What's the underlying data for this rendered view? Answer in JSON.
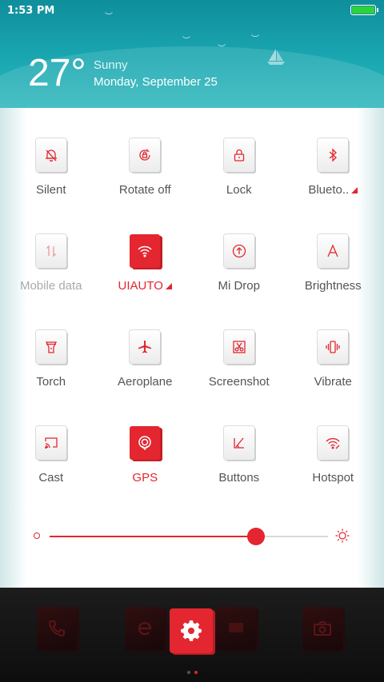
{
  "status_bar": {
    "time": "1:53 PM"
  },
  "weather": {
    "temperature": "27°",
    "condition": "Sunny",
    "date": "Monday, September 25"
  },
  "tiles": [
    {
      "name": "silent",
      "label": "Silent",
      "icon": "bell-off-icon"
    },
    {
      "name": "rotate-off",
      "label": "Rotate off",
      "icon": "rotation-lock-icon"
    },
    {
      "name": "lock",
      "label": "Lock",
      "icon": "padlock-icon"
    },
    {
      "name": "bluetooth",
      "label": "Blueto..",
      "icon": "bluetooth-icon"
    },
    {
      "name": "mobile-data",
      "label": "Mobile data",
      "icon": "data-arrows-icon"
    },
    {
      "name": "wifi",
      "label": "UIAUTO",
      "icon": "wifi-icon"
    },
    {
      "name": "mi-drop",
      "label": "Mi Drop",
      "icon": "upload-circle-icon"
    },
    {
      "name": "brightness",
      "label": "Brightness",
      "icon": "letter-a-icon"
    },
    {
      "name": "torch",
      "label": "Torch",
      "icon": "flashlight-icon"
    },
    {
      "name": "aeroplane",
      "label": "Aeroplane",
      "icon": "airplane-icon"
    },
    {
      "name": "screenshot",
      "label": "Screenshot",
      "icon": "scissors-icon"
    },
    {
      "name": "vibrate",
      "label": "Vibrate",
      "icon": "vibrate-icon"
    },
    {
      "name": "cast",
      "label": "Cast",
      "icon": "cast-icon"
    },
    {
      "name": "gps",
      "label": "GPS",
      "icon": "location-icon"
    },
    {
      "name": "buttons",
      "label": "Buttons",
      "icon": "buttons-icon"
    },
    {
      "name": "hotspot",
      "label": "Hotspot",
      "icon": "hotspot-icon"
    }
  ],
  "brightness": {
    "level": 0.74
  },
  "dock": {
    "apps": [
      "phone-icon",
      "browser-icon",
      "settings-icon",
      "messages-icon",
      "camera-icon"
    ]
  },
  "colors": {
    "accent": "#e3262f",
    "header": "#1aa7b1",
    "battery": "#2ed13a"
  }
}
